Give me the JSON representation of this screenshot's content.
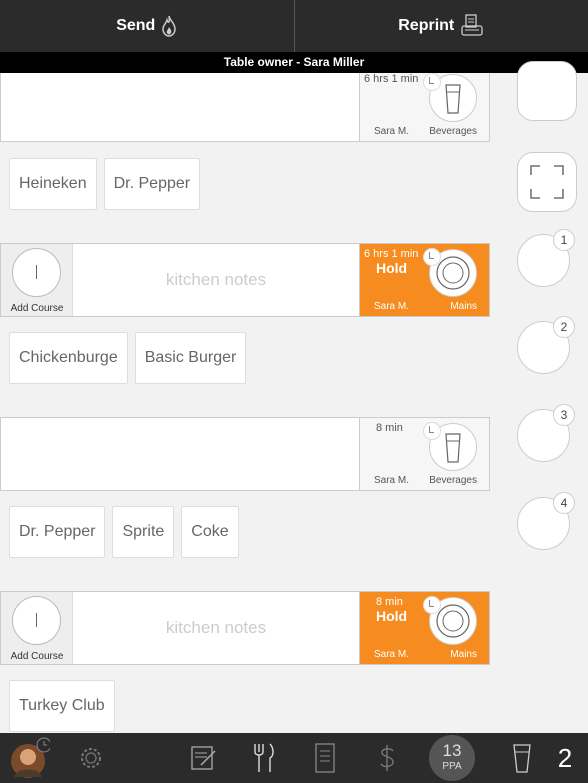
{
  "header": {
    "send_label": "Send",
    "reprint_label": "Reprint",
    "owner_text": "Table owner - Sara Miller"
  },
  "courses": [
    {
      "time": "6 hrs 1 min",
      "server": "Sara M.",
      "category": "Beverages",
      "hold": "",
      "notes": "",
      "add_course": ""
    },
    {
      "time": "6 hrs 1 min",
      "server": "Sara M.",
      "category": "Mains",
      "hold": "Hold",
      "notes": "kitchen notes",
      "add_course": "Add Course"
    },
    {
      "time": "8 min",
      "server": "Sara M.",
      "category": "Beverages",
      "hold": "",
      "notes": "",
      "add_course": ""
    },
    {
      "time": "8 min",
      "server": "Sara M.",
      "category": "Mains",
      "hold": "Hold",
      "notes": "kitchen notes",
      "add_course": "Add Course"
    }
  ],
  "item_groups": [
    [
      "Heineken",
      "Dr. Pepper"
    ],
    [
      "Chickenburge",
      "Basic Burger"
    ],
    [
      "Dr. Pepper",
      "Sprite",
      "Coke"
    ],
    [
      "Turkey Club"
    ]
  ],
  "seats": [
    "1",
    "2",
    "3",
    "4"
  ],
  "footer": {
    "ppa_value": "13",
    "ppa_label": "PPA",
    "guest_count": "2"
  },
  "icons": {
    "send": "flame-icon",
    "reprint": "printer-icon",
    "avatar": "user-avatar",
    "settings": "gear-icon",
    "notes": "notepad-icon",
    "menu": "fork-knife-icon",
    "receipt": "receipt-icon",
    "payment": "dollar-icon",
    "glass": "glass-icon"
  },
  "colors": {
    "header_bg": "#2b2b2b",
    "hold_orange": "#f68b1f"
  }
}
